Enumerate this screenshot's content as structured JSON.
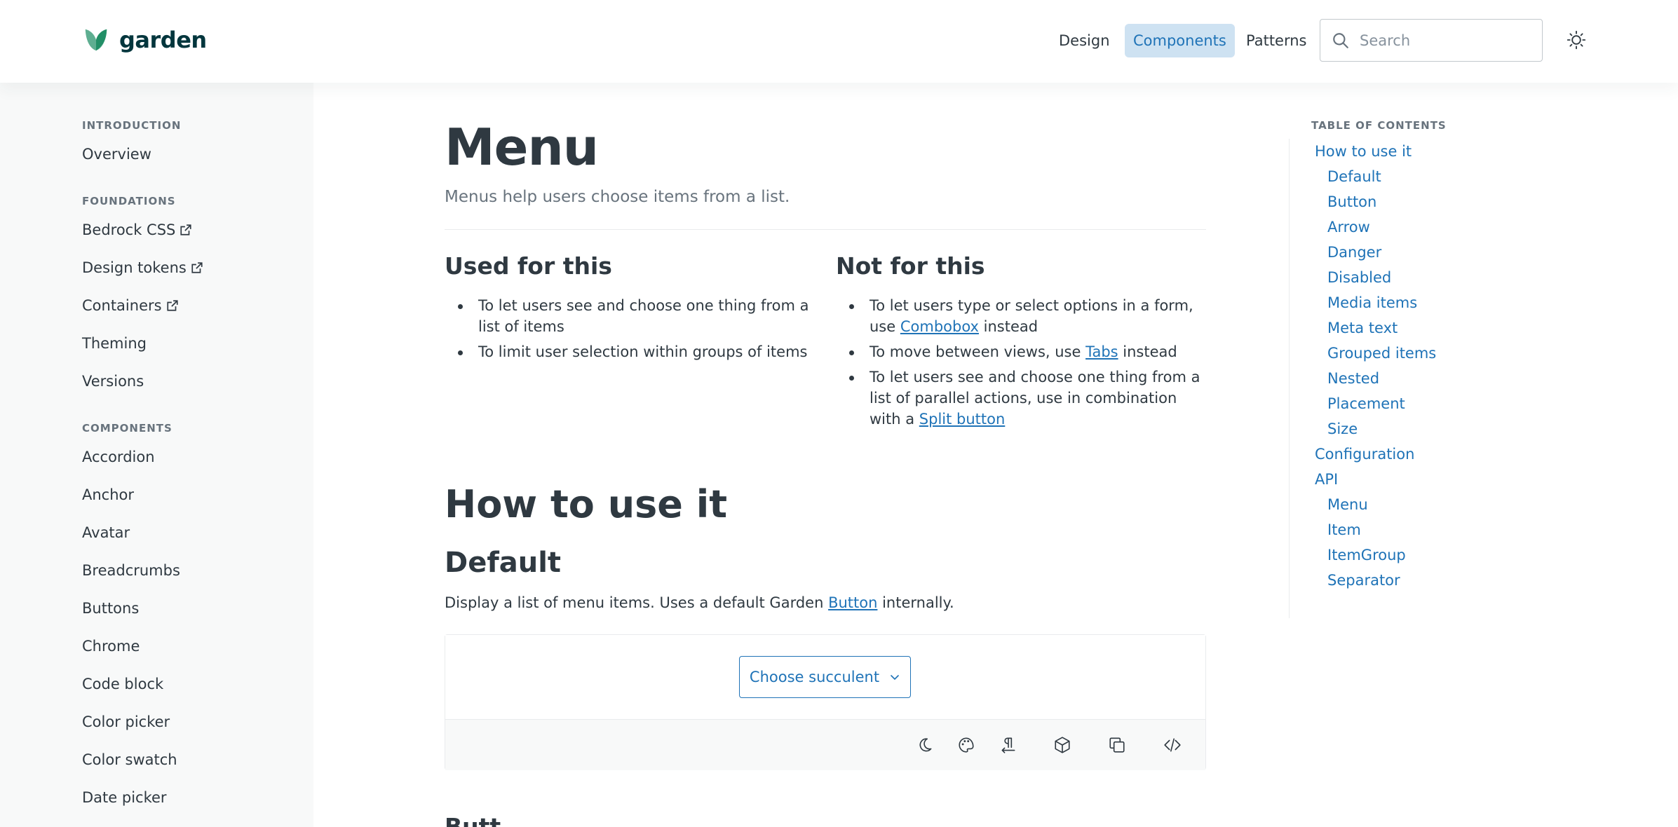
{
  "header": {
    "logo_text": "garden",
    "nav": [
      {
        "label": "Design"
      },
      {
        "label": "Components",
        "active": true
      },
      {
        "label": "Patterns"
      }
    ],
    "search_placeholder": "Search",
    "brand_color": "#17494d",
    "accent_color": "#1f73b7"
  },
  "sidebar": {
    "sections": [
      {
        "title": "INTRODUCTION",
        "items": [
          {
            "label": "Overview"
          }
        ]
      },
      {
        "title": "FOUNDATIONS",
        "items": [
          {
            "label": "Bedrock CSS",
            "external": true
          },
          {
            "label": "Design tokens",
            "external": true
          },
          {
            "label": "Containers",
            "external": true
          },
          {
            "label": "Theming"
          },
          {
            "label": "Versions"
          }
        ]
      },
      {
        "title": "COMPONENTS",
        "items": [
          {
            "label": "Accordion"
          },
          {
            "label": "Anchor"
          },
          {
            "label": "Avatar"
          },
          {
            "label": "Breadcrumbs"
          },
          {
            "label": "Buttons"
          },
          {
            "label": "Chrome"
          },
          {
            "label": "Code block"
          },
          {
            "label": "Color picker"
          },
          {
            "label": "Color swatch"
          },
          {
            "label": "Date picker"
          }
        ]
      }
    ]
  },
  "main": {
    "title": "Menu",
    "subtitle": "Menus help users choose items from a list.",
    "used_for": {
      "heading": "Used for this",
      "items": [
        "To let users see and choose one thing from a list of items",
        "To limit user selection within groups of items"
      ]
    },
    "not_for": {
      "heading": "Not for this",
      "item1": {
        "pre": "To let users type or select options in a form, use ",
        "link": "Combobox",
        "post": " instead"
      },
      "item2": {
        "pre": "To move between views, use ",
        "link": "Tabs",
        "post": " instead"
      },
      "item3": {
        "pre": "To let users see and choose one thing from a list of parallel actions, use in combination with a ",
        "link": "Split button",
        "post": ""
      }
    },
    "how_to_heading": "How to use it",
    "default_heading": "Default",
    "default_desc": {
      "pre": "Display a list of menu items. Uses a default Garden ",
      "link": "Button",
      "post": " internally."
    },
    "demo_button_label": "Choose succulent",
    "demo_tools": [
      "moon-icon",
      "palette-icon",
      "text-direction-icon",
      "sandbox-icon",
      "copy-icon",
      "code-icon"
    ],
    "next_heading_peek": "Butt"
  },
  "toc": {
    "label": "TABLE OF CONTENTS",
    "items": [
      {
        "label": "How to use it",
        "level": 1
      },
      {
        "label": "Default",
        "level": 2
      },
      {
        "label": "Button",
        "level": 2
      },
      {
        "label": "Arrow",
        "level": 2
      },
      {
        "label": "Danger",
        "level": 2
      },
      {
        "label": "Disabled",
        "level": 2
      },
      {
        "label": "Media items",
        "level": 2
      },
      {
        "label": "Meta text",
        "level": 2
      },
      {
        "label": "Grouped items",
        "level": 2
      },
      {
        "label": "Nested",
        "level": 2
      },
      {
        "label": "Placement",
        "level": 2
      },
      {
        "label": "Size",
        "level": 2
      },
      {
        "label": "Configuration",
        "level": 1
      },
      {
        "label": "API",
        "level": 1
      },
      {
        "label": "Menu",
        "level": 2
      },
      {
        "label": "Item",
        "level": 2
      },
      {
        "label": "ItemGroup",
        "level": 2
      },
      {
        "label": "Separator",
        "level": 2
      }
    ]
  }
}
